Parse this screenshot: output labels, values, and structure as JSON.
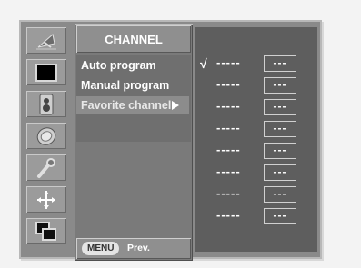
{
  "sidebar": {
    "icons": [
      {
        "name": "satellite-dish-icon"
      },
      {
        "name": "screen-icon"
      },
      {
        "name": "speaker-icon"
      },
      {
        "name": "clock-icon"
      },
      {
        "name": "key-icon"
      },
      {
        "name": "crossroad-arrows-icon"
      },
      {
        "name": "input-source-icon"
      }
    ]
  },
  "menu": {
    "title": "CHANNEL",
    "items": [
      {
        "label": "Auto program"
      },
      {
        "label": "Manual program"
      },
      {
        "label": "Favorite channel"
      }
    ],
    "footer": {
      "key_label": "MENU",
      "action_label": "Prev."
    }
  },
  "favorites": {
    "check_mark": "√",
    "slots": [
      {
        "name": "-----",
        "channel": "---",
        "checked": true
      },
      {
        "name": "-----",
        "channel": "---",
        "checked": false
      },
      {
        "name": "-----",
        "channel": "---",
        "checked": false
      },
      {
        "name": "-----",
        "channel": "---",
        "checked": false
      },
      {
        "name": "-----",
        "channel": "---",
        "checked": false
      },
      {
        "name": "-----",
        "channel": "---",
        "checked": false
      },
      {
        "name": "-----",
        "channel": "---",
        "checked": false
      },
      {
        "name": "-----",
        "channel": "---",
        "checked": false
      }
    ]
  }
}
